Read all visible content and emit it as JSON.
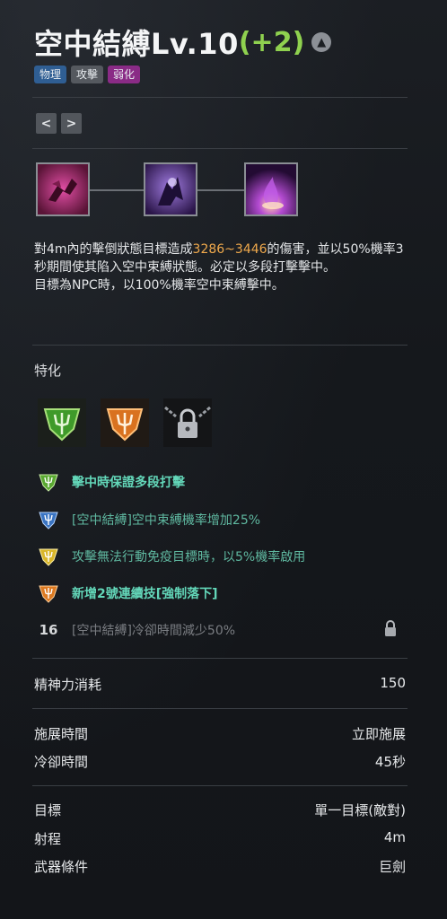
{
  "skill": {
    "name": "空中結縛Lv.10",
    "bonus": "(+2)",
    "upgrade_icon": "arrow-up-circle-icon",
    "tags": [
      "物理",
      "攻擊",
      "弱化"
    ],
    "tag_colors": [
      "#2f5e93",
      "#55595f",
      "#8a2b86"
    ]
  },
  "nav": {
    "prev": "<",
    "next": ">"
  },
  "combo_icons": [
    "claw-grab-skill-icon",
    "shadow-bind-skill-icon",
    "purple-flame-skill-icon"
  ],
  "description": {
    "part1": "對4m內的擊倒狀態目標造成",
    "damage": "3286~3446",
    "part2": "的傷害，並以50%機率3秒期間使其陷入空中束縛狀態。必定以多段打擊擊中。",
    "line2": "目標為NPC時，以100%機率空中束縛擊中。"
  },
  "specialization": {
    "label": "特化",
    "gems": [
      "green-trident-gem-icon",
      "orange-trident-gem-icon",
      "padlock-chain-icon"
    ],
    "items": [
      {
        "icon": "green-trident-badge-icon",
        "text": "擊中時保證多段打擊"
      },
      {
        "icon": "blue-trident-badge-icon",
        "text": "[空中結縛]空中束縛機率增加25%"
      },
      {
        "icon": "yellow-trident-badge-icon",
        "text": "攻擊無法行動免疫目標時，以5%機率啟用"
      },
      {
        "icon": "orange-trident-badge-icon",
        "text": "新增2號連續技[強制落下]"
      },
      {
        "level": "16",
        "text": "[空中結縛]冷卻時間減少50%",
        "lock_icon": "lock-icon"
      }
    ]
  },
  "stats": {
    "spirit_label": "精神力消耗",
    "spirit_value": "150",
    "cast_label": "施展時間",
    "cast_value": "立即施展",
    "cooldown_label": "冷卻時間",
    "cooldown_value": "45秒",
    "target_label": "目標",
    "target_value": "單一目標(敵對)",
    "range_label": "射程",
    "range_value": "4m",
    "weapon_label": "武器條件",
    "weapon_value": "巨劍"
  }
}
